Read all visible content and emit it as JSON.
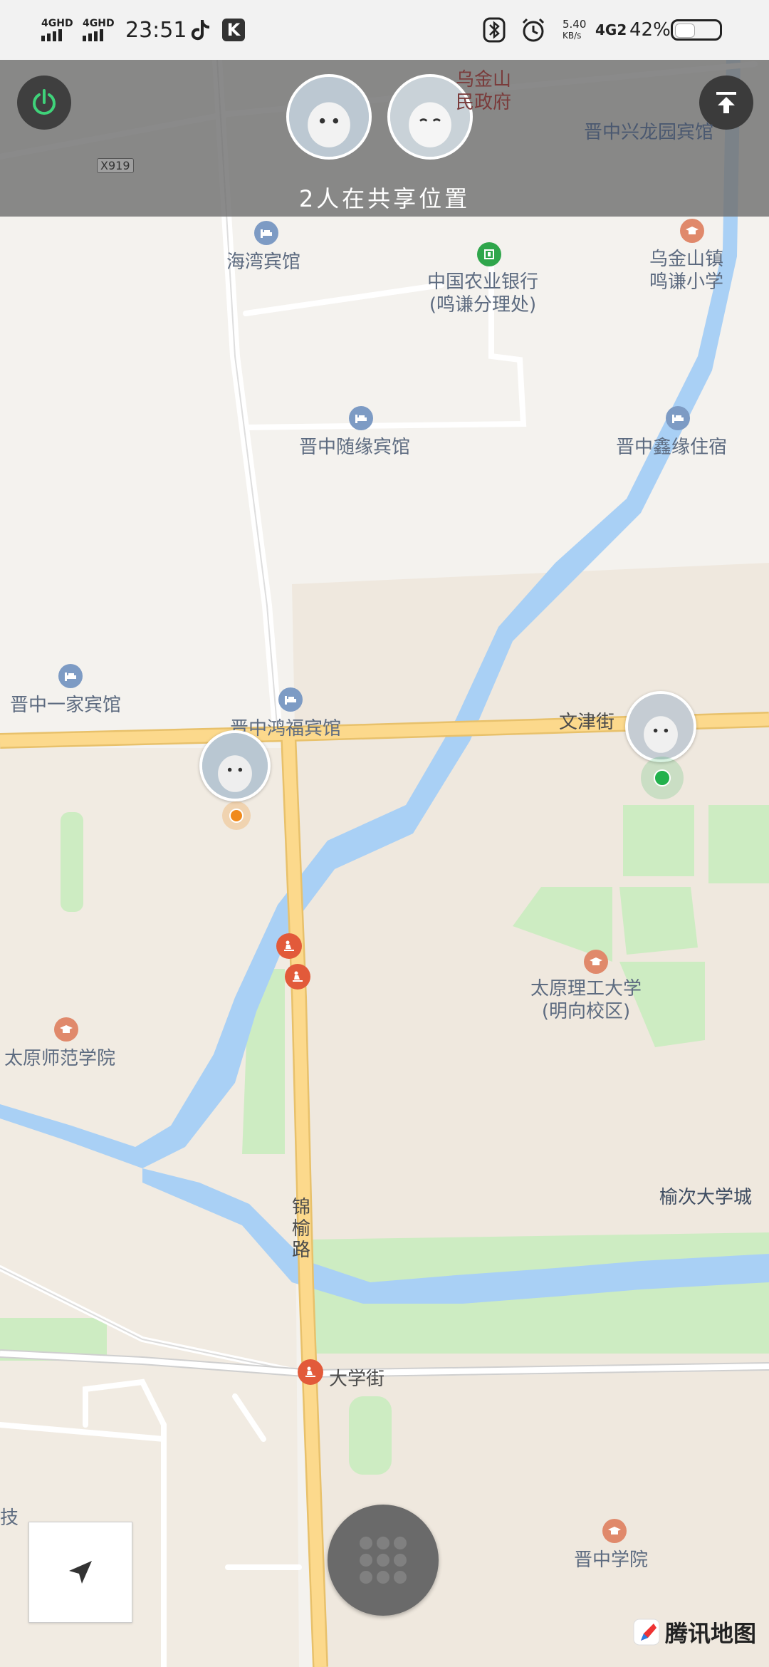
{
  "status_bar": {
    "signal1": "4GHD",
    "signal2": "4GHD",
    "time": "23:51",
    "speed_value": "5.40",
    "speed_unit": "KB/s",
    "network": "4G2",
    "battery": "42%"
  },
  "share_header": {
    "text": "2人在共享位置"
  },
  "map_labels": {
    "gov_partial_1": "乌金山",
    "gov_partial_2": "民政府",
    "xinglong": "晋中兴龙园宾馆",
    "road_x919": "X919",
    "haiwan": "海湾宾馆",
    "abc_bank_1": "中国农业银行",
    "abc_bank_2": "(鸣谦分理处)",
    "wujinshan_1": "乌金山镇",
    "wujinshan_2": "鸣谦小学",
    "suiyuan": "晋中随缘宾馆",
    "xinyuan": "晋中鑫缘住宿",
    "yijia": "晋中一家宾馆",
    "hongfu": "晋中鸿福宾馆",
    "wenjin": "文津街",
    "tyut_1": "太原理工大学",
    "tyut_2": "(明向校区)",
    "normal": "太原师范学院",
    "yuci_city": "榆次大学城",
    "jinyu_1": "锦",
    "jinyu_2": "榆",
    "jinyu_3": "路",
    "daxue": "大学街",
    "jz_college": "晋中学院",
    "left_partial": "技"
  },
  "brand": {
    "name": "腾讯地图"
  },
  "colors": {
    "water": "#a9d0f5",
    "road_main": "#fcd98c",
    "road_minor": "#ffffff",
    "green_area": "#cdecc2",
    "campus": "#efe9df",
    "header_overlay": "#707070",
    "my_location": "#f08a1c",
    "friend_location": "#22b14c"
  },
  "icons": {
    "power": "power-icon",
    "scroll_top": "arrow-up-to-top-icon",
    "locate": "navigation-arrow-icon",
    "menu": "grid-dots-icon"
  }
}
